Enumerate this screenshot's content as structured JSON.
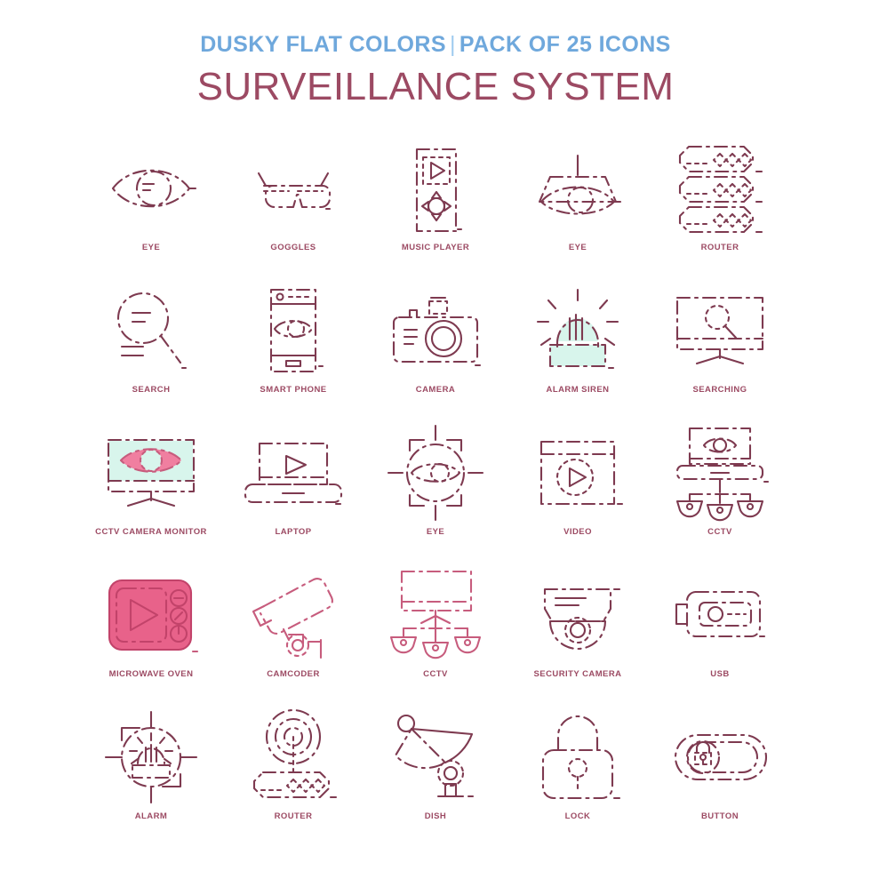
{
  "header": {
    "kicker_left": "DUSKY FLAT COLORS",
    "separator": "|",
    "kicker_right": "PACK OF 25 ICONS",
    "title": "SURVEILLANCE SYSTEM",
    "kicker_color": "#6FA8DC",
    "title_color": "#9C4A63"
  },
  "palette": {
    "outline_dark": "#7E3A50",
    "outline_rose": "#C75C7D",
    "accent_pink": "#E8628A",
    "accent_mint": "#D8F5EC",
    "background": "#FFFFFF"
  },
  "grid": {
    "columns": 5,
    "rows": 5,
    "total_icons": 25
  },
  "icons": [
    {
      "label": "EYE",
      "icon": "eye-icon",
      "style": "dark"
    },
    {
      "label": "GOGGLES",
      "icon": "goggles-icon",
      "style": "dark"
    },
    {
      "label": "MUSIC PLAYER",
      "icon": "music-player-icon",
      "style": "dark"
    },
    {
      "label": "EYE",
      "icon": "eye-hooded-icon",
      "style": "dark"
    },
    {
      "label": "ROUTER",
      "icon": "router-stack-icon",
      "style": "dark"
    },
    {
      "label": "SEARCH",
      "icon": "search-magnifier-icon",
      "style": "dark"
    },
    {
      "label": "SMART PHONE",
      "icon": "smart-phone-icon",
      "style": "dark"
    },
    {
      "label": "CAMERA",
      "icon": "camera-icon",
      "style": "dark"
    },
    {
      "label": "ALARM SIREN",
      "icon": "alarm-siren-icon",
      "style": "dark-mint"
    },
    {
      "label": "SEARCHING",
      "icon": "searching-monitor-icon",
      "style": "dark"
    },
    {
      "label": "CCTV CAMERA MONITOR",
      "icon": "cctv-camera-monitor-icon",
      "style": "dark-mint-pink"
    },
    {
      "label": "LAPTOP",
      "icon": "laptop-icon",
      "style": "dark"
    },
    {
      "label": "EYE",
      "icon": "eye-target-icon",
      "style": "dark"
    },
    {
      "label": "VIDEO",
      "icon": "video-window-icon",
      "style": "dark"
    },
    {
      "label": "CCTV",
      "icon": "cctv-laptop-icon",
      "style": "dark"
    },
    {
      "label": "MICROWAVE OVEN",
      "icon": "microwave-oven-icon",
      "style": "pink-filled"
    },
    {
      "label": "CAMCODER",
      "icon": "camcoder-icon",
      "style": "rose"
    },
    {
      "label": "CCTV",
      "icon": "cctv-monitor-icon",
      "style": "rose"
    },
    {
      "label": "SECURITY CAMERA",
      "icon": "security-camera-icon",
      "style": "dark"
    },
    {
      "label": "USB",
      "icon": "usb-icon",
      "style": "dark"
    },
    {
      "label": "ALARM",
      "icon": "alarm-target-icon",
      "style": "dark"
    },
    {
      "label": "ROUTER",
      "icon": "router-signal-icon",
      "style": "dark"
    },
    {
      "label": "DISH",
      "icon": "satellite-dish-icon",
      "style": "dark"
    },
    {
      "label": "LOCK",
      "icon": "lock-icon",
      "style": "dark"
    },
    {
      "label": "BUTTON",
      "icon": "toggle-button-lock-icon",
      "style": "dark"
    }
  ]
}
